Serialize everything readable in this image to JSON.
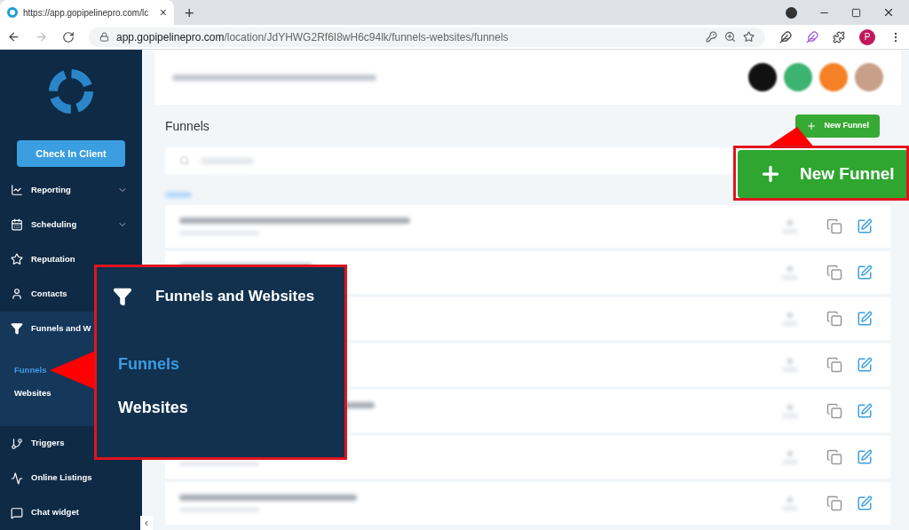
{
  "browser": {
    "tab_title": "https://app.gopipelinepro.com/lc",
    "tab_close": "×",
    "new_tab": "+",
    "url_host": "app.gopipelinepro.com",
    "url_path": "/location/JdYHWG2Rf6I8wH6c94lk/funnels-websites/funnels",
    "profile_initial": "P"
  },
  "sidebar": {
    "check_in_button": "Check In Client",
    "items": [
      {
        "kind": "chart",
        "label": "Reporting",
        "chevron": true,
        "expanded": false
      },
      {
        "kind": "calendar",
        "label": "Scheduling",
        "chevron": true,
        "expanded": false
      },
      {
        "kind": "star",
        "label": "Reputation",
        "expanded": false
      },
      {
        "kind": "person",
        "label": "Contacts",
        "expanded": false
      },
      {
        "kind": "funnel",
        "label": "Funnels and W",
        "expanded": true,
        "children": [
          {
            "label": "Funnels",
            "selected": true
          },
          {
            "label": "Websites",
            "selected": false
          }
        ]
      },
      {
        "kind": "branch",
        "label": "Triggers",
        "expanded": false
      },
      {
        "kind": "pulse",
        "label": "Online Listings",
        "expanded": false
      },
      {
        "kind": "chat",
        "label": "Chat widget",
        "expanded": false
      }
    ],
    "collapse": "‹"
  },
  "main": {
    "header_buttons": [
      {
        "color": "#111111"
      },
      {
        "color": "#3cb371"
      },
      {
        "color": "#f58025"
      },
      {
        "color": "#c8a08a"
      }
    ],
    "title": "Funnels",
    "new_button": "New Funnel"
  },
  "callouts": {
    "menu": {
      "title": "Funnels and Websites",
      "items": [
        {
          "label": "Funnels",
          "selected": true
        },
        {
          "label": "Websites",
          "selected": false
        }
      ]
    },
    "button": {
      "label": "New Funnel"
    }
  }
}
